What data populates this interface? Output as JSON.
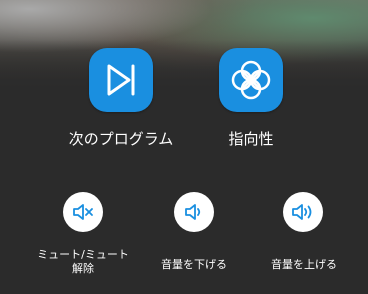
{
  "colors": {
    "accent": "#1a8fe0",
    "background": "#2b2b2b",
    "text": "#ffffff",
    "small_button_bg": "#ffffff"
  },
  "controls": {
    "next_program": {
      "label": "次のプログラム",
      "icon": "skip-next-icon"
    },
    "directivity": {
      "label": "指向性",
      "icon": "directivity-icon"
    },
    "mute": {
      "label_line1": "ミュート/ミュート",
      "label_line2": "解除",
      "icon": "speaker-mute-icon"
    },
    "volume_down": {
      "label": "音量を下げる",
      "icon": "speaker-low-icon"
    },
    "volume_up": {
      "label": "音量を上げる",
      "icon": "speaker-high-icon"
    }
  }
}
